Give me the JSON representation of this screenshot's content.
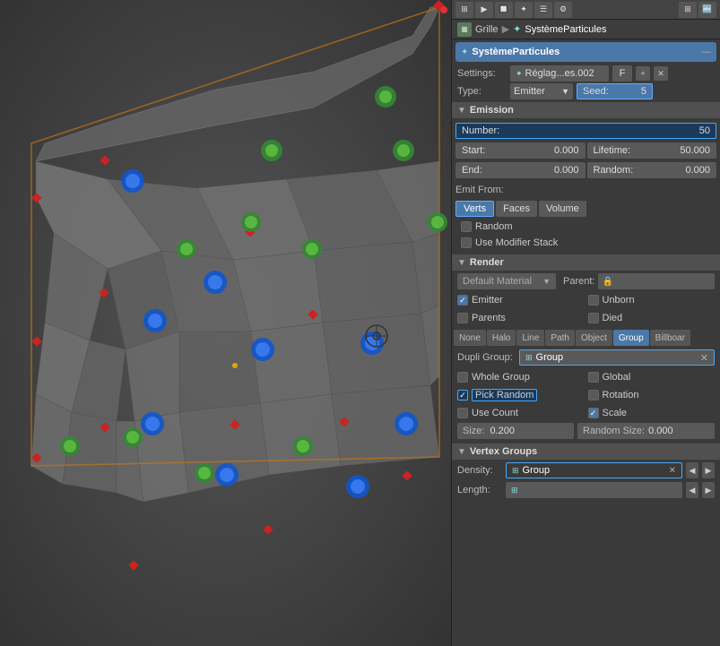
{
  "viewport": {
    "bg_color": "#4a4a4a"
  },
  "toolbar": {
    "icons": [
      "⊞",
      "▶",
      "🔲",
      "✦",
      "☰",
      "⚙"
    ]
  },
  "breadcrumb": {
    "grid_icon": "▦",
    "grid_label": "Grille",
    "particle_icon": "✦",
    "particle_label": "SystèmeParticules"
  },
  "panel_header": {
    "title": "SystèmeParticules",
    "icon": "✦",
    "minus": "—"
  },
  "settings_row": {
    "label": "Settings:",
    "icon": "✦",
    "field_value": "Réglag...es.002",
    "f_label": "F",
    "plus": "+",
    "x": "✕"
  },
  "type_row": {
    "label": "Type:",
    "dropdown_value": "Emitter",
    "seed_label": "Seed:",
    "seed_value": "5"
  },
  "emission_section": {
    "title": "Emission",
    "number_label": "Number:",
    "number_value": "50",
    "start_label": "Start:",
    "start_value": "0.000",
    "lifetime_label": "Lifetime:",
    "lifetime_value": "50.000",
    "end_label": "End:",
    "end_value": "0.000",
    "random_label": "Random:",
    "random_value": "0.000",
    "emit_from_label": "Emit From:",
    "verts_label": "Verts",
    "faces_label": "Faces",
    "volume_label": "Volume",
    "random_check_label": "Random",
    "use_modifier_label": "Use Modifier Stack"
  },
  "render_section": {
    "title": "Render",
    "material_label": "Default Material",
    "parent_label": "Parent:",
    "emitter_label": "Emitter",
    "unborn_label": "Unborn",
    "parents_label": "Parents",
    "died_label": "Died",
    "tab_none": "None",
    "tab_halo": "Halo",
    "tab_line": "Line",
    "tab_path": "Path",
    "tab_object": "Object",
    "tab_group": "Group",
    "tab_billboard": "Billboar",
    "dupli_group_label": "Dupli Group:",
    "dupli_group_icon": "⊞",
    "dupli_group_value": "Group",
    "whole_group_label": "Whole Group",
    "global_label": "Global",
    "pick_random_label": "Pick Random",
    "rotation_label": "Rotation",
    "use_count_label": "Use Count",
    "scale_label": "Scale",
    "size_label": "Size:",
    "size_value": "0.200",
    "random_size_label": "Random Size:",
    "random_size_value": "0.000"
  },
  "vertex_groups": {
    "title": "Vertex Groups",
    "density_label": "Density:",
    "density_icon": "⊞",
    "density_value": "Group",
    "length_label": "Length:",
    "length_icon": "⊞"
  }
}
